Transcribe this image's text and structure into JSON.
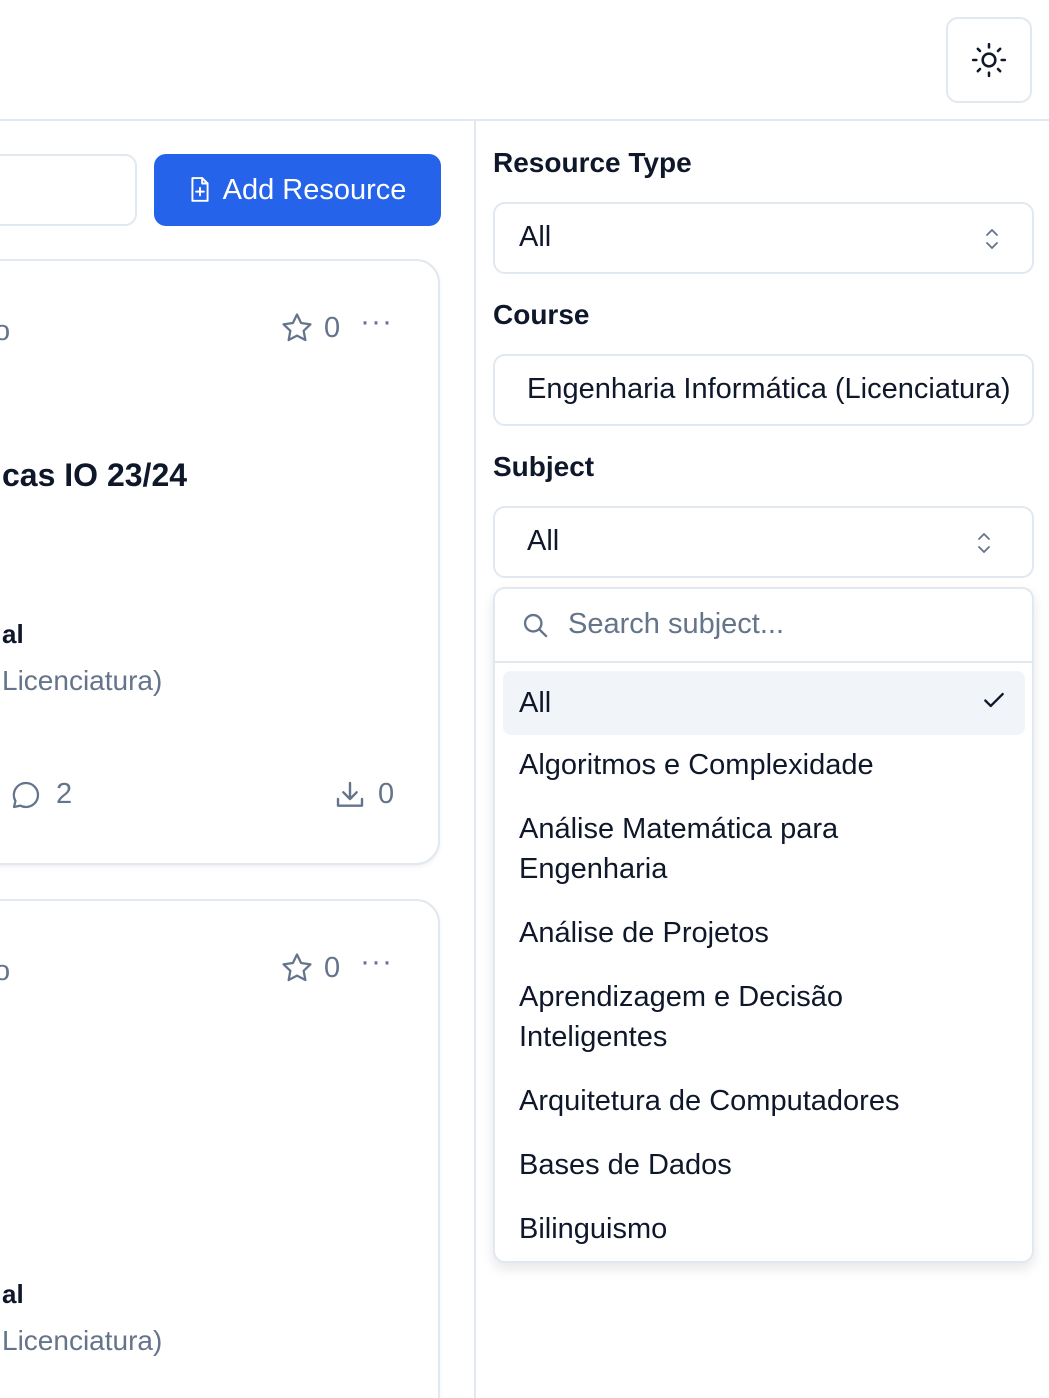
{
  "header": {
    "theme_toggle_icon": "sun-icon"
  },
  "toolbar": {
    "add_resource_label": "Add Resource"
  },
  "cards": [
    {
      "stub_text": "o",
      "stars": "0",
      "more": "···",
      "title": "cas IO 23/24",
      "institution": "al",
      "course": "Licenciatura)",
      "comments": "2",
      "downloads": "0"
    },
    {
      "stub_text": "o",
      "stars": "0",
      "more": "···",
      "institution": "al",
      "course": "Licenciatura)"
    }
  ],
  "filters": {
    "resource_type": {
      "label": "Resource Type",
      "value": "All"
    },
    "course": {
      "label": "Course",
      "value": "Engenharia Informática (Licenciatura)"
    },
    "subject": {
      "label": "Subject",
      "value": "All",
      "search_placeholder": "Search subject...",
      "options": [
        "All",
        "Algoritmos e Complexidade",
        "Análise Matemática para",
        "Engenharia",
        "Análise de Projetos",
        "Aprendizagem e Decisão",
        "Inteligentes",
        "Arquitetura de Computadores",
        "Bases de Dados",
        "Bilinguismo"
      ],
      "selected_option": "All"
    }
  },
  "colors": {
    "accent": "#2563eb",
    "muted_text": "#64748b",
    "border": "#e2e8f0",
    "selected_bg": "#f1f5f9"
  }
}
